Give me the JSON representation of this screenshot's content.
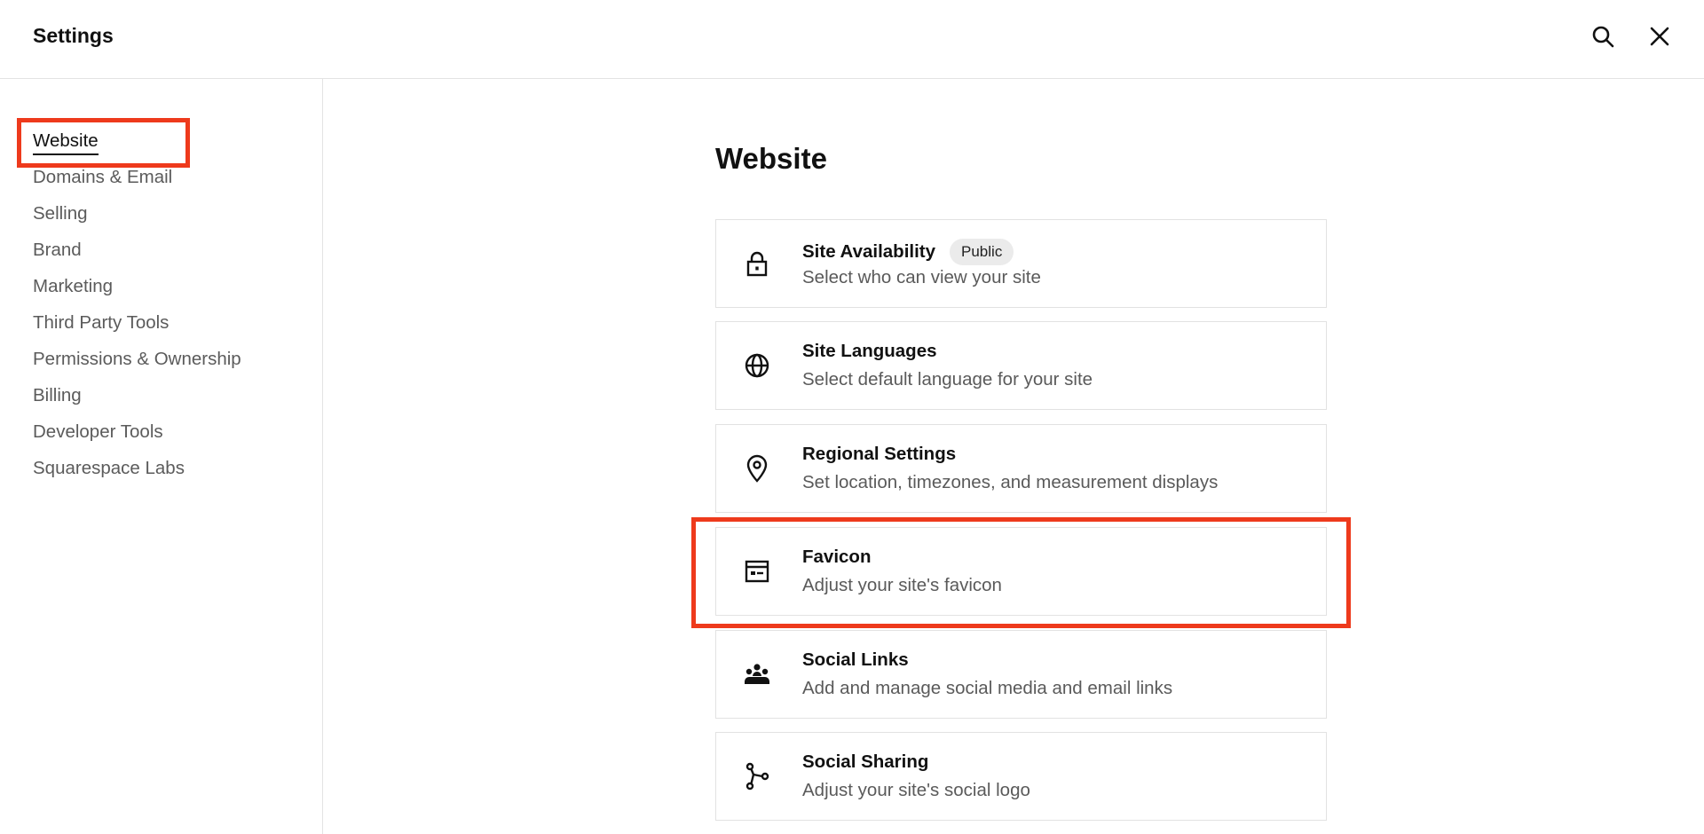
{
  "header": {
    "title": "Settings",
    "search_icon": "search-icon",
    "close_icon": "close-icon"
  },
  "sidebar": {
    "items": [
      {
        "label": "Website",
        "active": true
      },
      {
        "label": "Domains & Email"
      },
      {
        "label": "Selling"
      },
      {
        "label": "Brand"
      },
      {
        "label": "Marketing"
      },
      {
        "label": "Third Party Tools"
      },
      {
        "label": "Permissions & Ownership"
      },
      {
        "label": "Billing"
      },
      {
        "label": "Developer Tools"
      },
      {
        "label": "Squarespace Labs"
      }
    ]
  },
  "main": {
    "title": "Website",
    "cards": [
      {
        "title": "Site Availability",
        "badge": "Public",
        "subtitle": "Select who can view your site",
        "icon": "lock-icon"
      },
      {
        "title": "Site Languages",
        "subtitle": "Select default language for your site",
        "icon": "globe-icon"
      },
      {
        "title": "Regional Settings",
        "subtitle": "Set location, timezones, and measurement displays",
        "icon": "location-pin-icon"
      },
      {
        "title": "Favicon",
        "subtitle": "Adjust your site's favicon",
        "icon": "browser-window-icon"
      },
      {
        "title": "Social Links",
        "subtitle": "Add and manage social media and email links",
        "icon": "people-icon"
      },
      {
        "title": "Social Sharing",
        "subtitle": "Adjust your site's social logo",
        "icon": "share-nodes-icon"
      }
    ]
  },
  "colors": {
    "highlight": "#ee3a1c",
    "text_primary": "#111111",
    "text_secondary": "#5a5a5a",
    "border": "#e2e2e2"
  }
}
